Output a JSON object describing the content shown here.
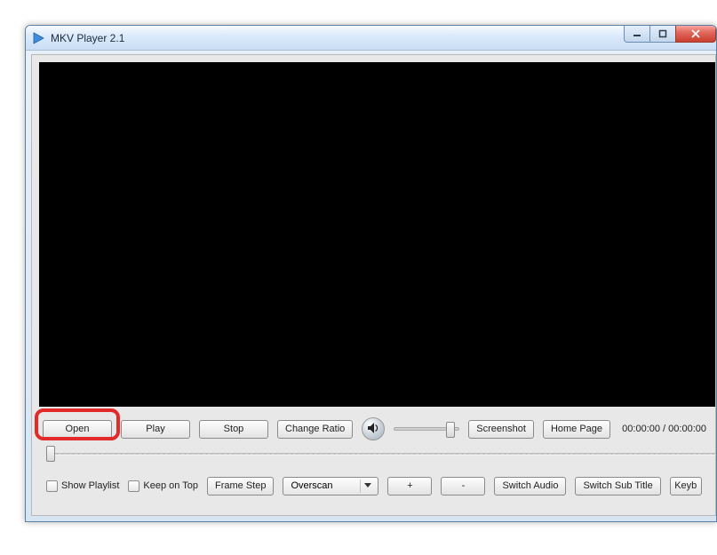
{
  "window": {
    "title": "MKV Player 2.1"
  },
  "controls": {
    "open": "Open",
    "play": "Play",
    "stop": "Stop",
    "changeRatio": "Change Ratio",
    "screenshot": "Screenshot",
    "homePage": "Home Page"
  },
  "time": {
    "current": "00:00:00",
    "sep": " / ",
    "total": "00:00:00"
  },
  "row2": {
    "showPlaylist": "Show Playlist",
    "keepOnTop": "Keep on Top",
    "frameStep": "Frame Step",
    "overscanSelected": "Overscan",
    "plus": "+",
    "minus": "-",
    "switchAudio": "Switch Audio",
    "switchSubTitle": "Switch Sub Title",
    "keyb": "Keyb"
  }
}
